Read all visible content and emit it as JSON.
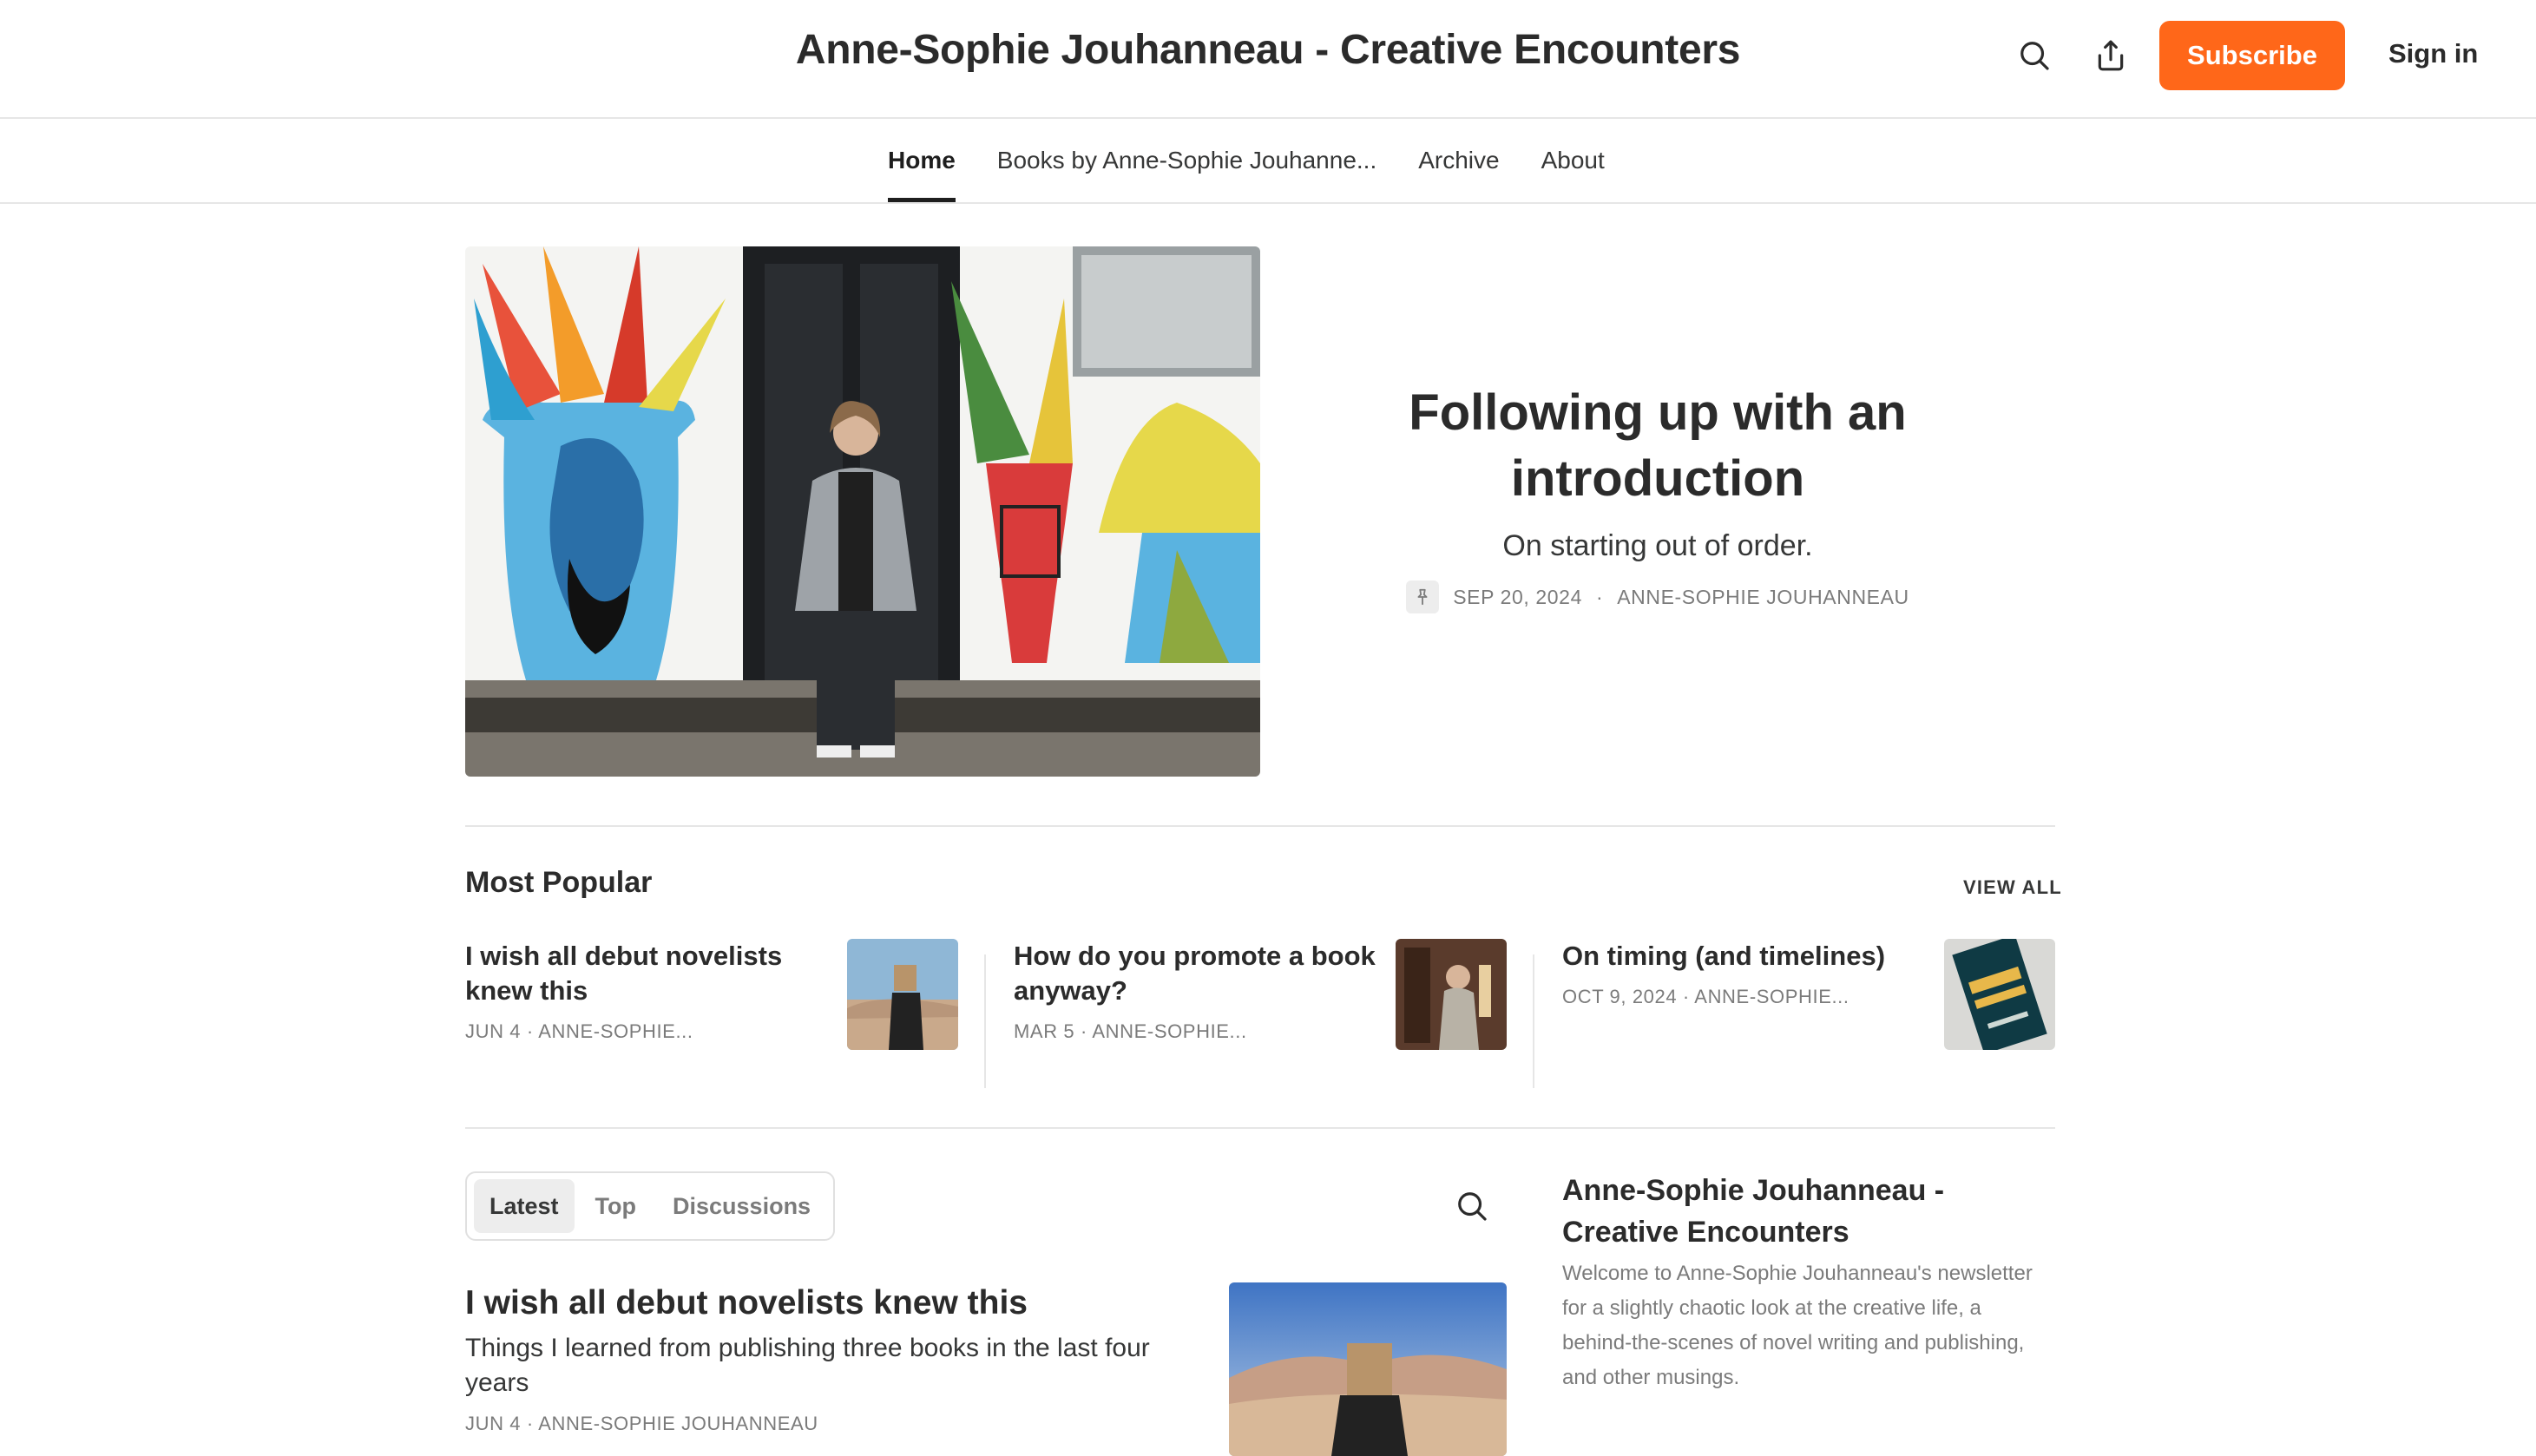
{
  "header": {
    "title": "Anne-Sophie Jouhanneau - Creative Encounters",
    "subscribe_label": "Subscribe",
    "signin_label": "Sign in",
    "icons": [
      "search-icon",
      "share-icon"
    ]
  },
  "nav": {
    "items": [
      {
        "label": "Home",
        "active": true
      },
      {
        "label": "Books by Anne-Sophie Jouhanne..."
      },
      {
        "label": "Archive"
      },
      {
        "label": "About"
      }
    ]
  },
  "hero": {
    "title": "Following up with an introduction",
    "subtitle": "On starting out of order.",
    "date": "SEP 20, 2024",
    "author": "ANNE-SOPHIE JOUHANNEAU",
    "pinned_icon": "pin-icon"
  },
  "popular": {
    "title": "Most Popular",
    "view_all": "VIEW ALL",
    "items": [
      {
        "title": "I wish all debut novelists knew this",
        "meta": "JUN 4 · ANNE-SOPHIE..."
      },
      {
        "title": "How do you promote a book anyway?",
        "meta": "MAR 5 · ANNE-SOPHIE..."
      },
      {
        "title": "On timing (and timelines)",
        "meta": "OCT 9, 2024 · ANNE-SOPHIE..."
      }
    ]
  },
  "feed": {
    "tabs": [
      {
        "label": "Latest",
        "active": true
      },
      {
        "label": "Top"
      },
      {
        "label": "Discussions"
      }
    ],
    "posts": [
      {
        "title": "I wish all debut novelists knew this",
        "subtitle": "Things I learned from publishing three books in the last four years",
        "meta": "JUN 4 · ANNE-SOPHIE JOUHANNEAU"
      }
    ]
  },
  "sidebar": {
    "title": "Anne-Sophie Jouhanneau - Creative Encounters",
    "description": "Welcome to Anne-Sophie Jouhanneau's newsletter for a slightly chaotic look at the creative life, a behind-the-scenes of novel writing and publishing, and other musings."
  },
  "colors": {
    "accent": "#ff6719",
    "text": "#363737",
    "muted": "#7b7b7b",
    "divider": "#e6e6e6"
  }
}
